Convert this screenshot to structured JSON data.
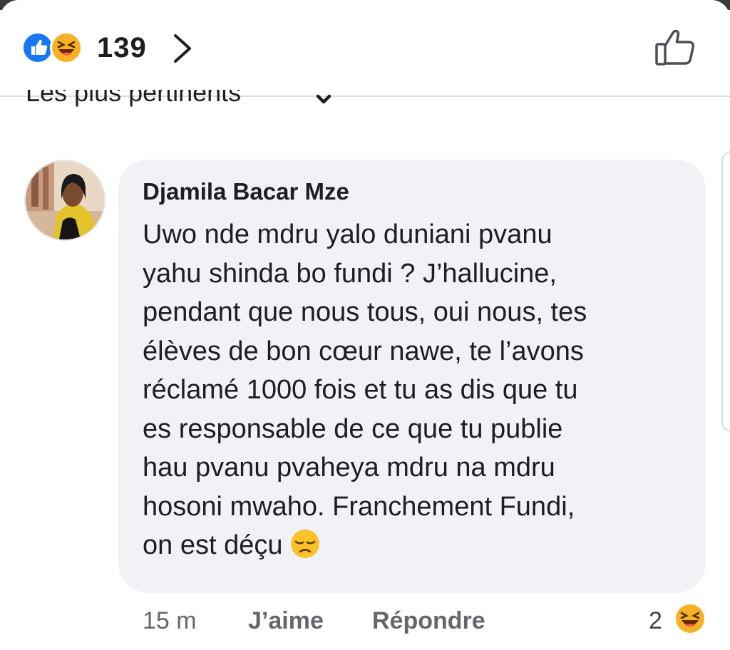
{
  "reactions": {
    "count": "139",
    "icons": [
      "like-icon",
      "haha-icon"
    ],
    "like_color": "#1877f2",
    "haha_color": "#f7b125"
  },
  "sort": {
    "label": "Les plus pertinents"
  },
  "comment": {
    "author": "Djamila Bacar Mze",
    "body": "Uwo nde mdru yalo duniani pvanu\nyahu shinda bo fundi ? J’hallucine,\npendant que nous tous, oui nous, tes\nélèves de bon cœur nawe, te l’avons\nréclamé 1000 fois et tu as dis que tu\nes responsable de ce que tu publie\nhau pvanu pvaheya mdru na mdru\nhosoni mwaho. Franchement Fundi,\non est déçu",
    "body_emoji": "disappointed-face-icon",
    "time": "15 m",
    "like_label": "J’aime",
    "reply_label": "Répondre",
    "reaction_count": "2",
    "reaction_icon": "haha-icon"
  },
  "colors": {
    "bubble": "#f0f2f5",
    "muted_text": "#65676b"
  }
}
